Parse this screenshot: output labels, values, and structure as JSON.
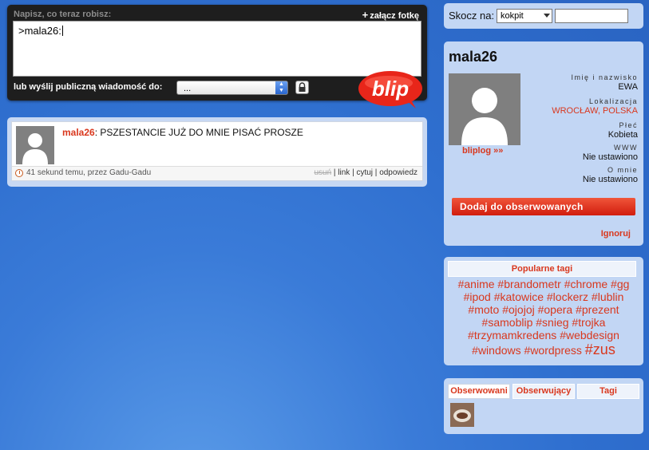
{
  "composer": {
    "prompt": "Napisz, co teraz robisz:",
    "attach_label": "załącz fotkę",
    "message_value": ">mala26:",
    "public_label": "lub wyślij publiczną wiadomość do:",
    "recipient_value": "..."
  },
  "status": {
    "author": "mala26",
    "separator": ":",
    "text": " PSZESTANCIE JUŻ DO MNIE PISAĆ PROSZE",
    "time": "41 sekund temu, przez Gadu-Gadu",
    "actions": [
      "usuń",
      "link",
      "cytuj",
      "odpowiedz"
    ]
  },
  "jump": {
    "label": "Skocz na:",
    "select_value": "kokpit",
    "input_value": ""
  },
  "profile": {
    "username": "mala26",
    "bliplog_link": "bliplog »»",
    "name_label": "Imię i nazwisko",
    "name_value": "EWA",
    "location_label": "Lokalizacja",
    "location_value": "WROCŁAW, POLSKA",
    "gender_label": "Płeć",
    "gender_value": "Kobieta",
    "www_label": "WWW",
    "www_value": "Nie ustawiono",
    "about_label": "O mnie",
    "about_value": "Nie ustawiono",
    "follow_button": "Dodaj do obserwowanych",
    "ignore_link": "Ignoruj"
  },
  "tags": {
    "title": "Popularne tagi",
    "line1": [
      "#anime",
      "#brandometr",
      "#chrome",
      "#gg"
    ],
    "line2": [
      "#ipod",
      "#katowice",
      "#lockerz",
      "#lublin"
    ],
    "line3": [
      "#moto",
      "#ojojoj",
      "#opera",
      "#prezent"
    ],
    "line4": [
      "#samoblip",
      "#snieg",
      "#trojka"
    ],
    "line5": [
      "#trzymamkredens",
      "#webdesign"
    ],
    "line6": [
      "#windows",
      "#wordpress",
      "#zus"
    ]
  },
  "observe": {
    "tabs": [
      "Obserwowani",
      "Obserwujący",
      "Tagi"
    ]
  },
  "colors": {
    "accent_red": "#d9381e",
    "panel_blue": "#c2d6f4",
    "background_blue": "#3a7bd8"
  }
}
